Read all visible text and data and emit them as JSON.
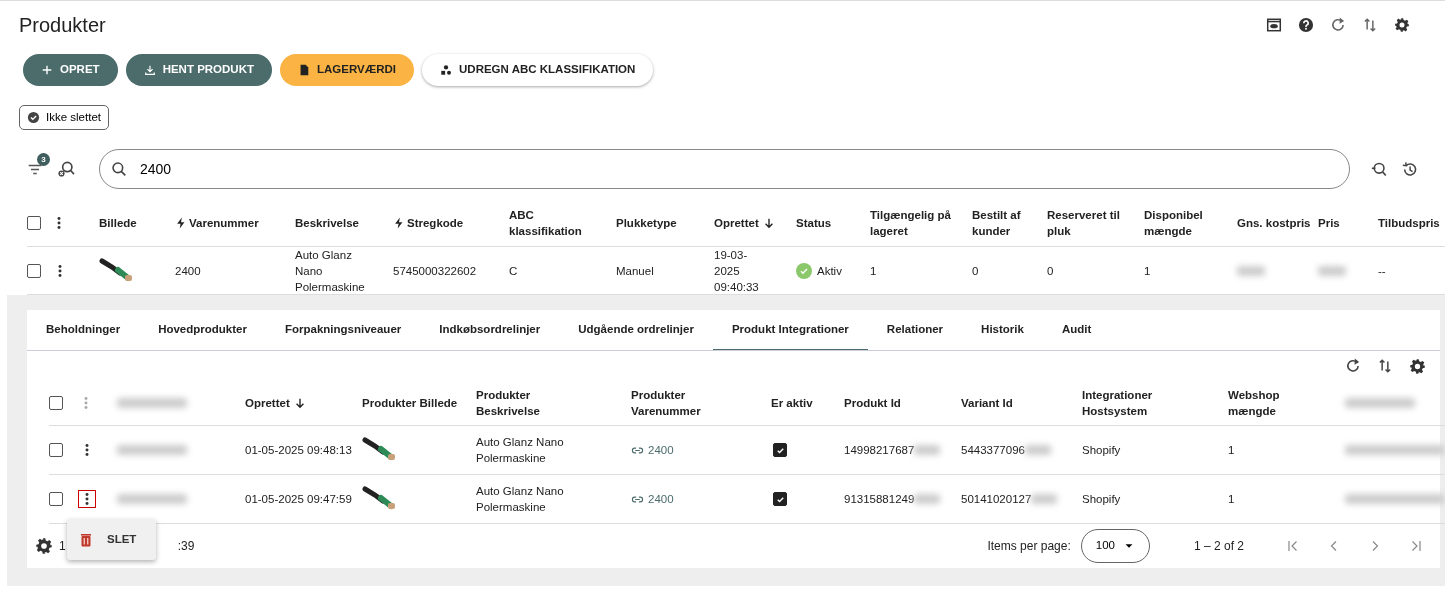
{
  "title": "Produkter",
  "action_buttons": [
    {
      "label": "OPRET",
      "kind": "primary"
    },
    {
      "label": "HENT PRODUKT",
      "kind": "primary"
    },
    {
      "label": "LAGERVÆRDI",
      "kind": "warning"
    },
    {
      "label": "UDREGN ABC KLASSIFIKATION",
      "kind": "light"
    }
  ],
  "filter_chip": {
    "label": "Ikke slettet",
    "checked": true
  },
  "filter_badge": "3",
  "search": {
    "value": "2400"
  },
  "table": {
    "all_selected": false,
    "columns": [
      {
        "label": "Billede"
      },
      {
        "label": "Varenummer",
        "quick": true
      },
      {
        "label": "Beskrivelse"
      },
      {
        "label": "Stregkode",
        "quick": true
      },
      {
        "label": "ABC klassifikation"
      },
      {
        "label": "Plukketype"
      },
      {
        "label": "Oprettet",
        "sorted": true
      },
      {
        "label": "Status"
      },
      {
        "label": "Tilgængelig på lageret"
      },
      {
        "label": "Bestilt af kunder"
      },
      {
        "label": "Reserveret til pluk"
      },
      {
        "label": "Disponibel mængde"
      },
      {
        "label": "Gns. kostpris"
      },
      {
        "label": "Pris"
      },
      {
        "label": "Tilbudspris"
      }
    ],
    "rows": [
      {
        "selected": false,
        "cells": [
          {
            "kind": "image"
          },
          {
            "kind": "text",
            "text": "2400"
          },
          {
            "kind": "text",
            "text": "Auto Glanz Nano Polermaskine"
          },
          {
            "kind": "text",
            "text": "5745000322602"
          },
          {
            "kind": "text",
            "text": "C"
          },
          {
            "kind": "text",
            "text": "Manuel"
          },
          {
            "kind": "text",
            "text": "19-03-2025 09:40:33"
          },
          {
            "kind": "status",
            "text": "Aktiv",
            "active": true
          },
          {
            "kind": "text",
            "text": "1"
          },
          {
            "kind": "text",
            "text": "0"
          },
          {
            "kind": "text",
            "text": "0"
          },
          {
            "kind": "text",
            "text": "1"
          },
          {
            "kind": "redacted"
          },
          {
            "kind": "redacted"
          },
          {
            "kind": "text",
            "text": "--"
          }
        ]
      }
    ]
  },
  "detail_tabs": [
    {
      "label": "Beholdninger",
      "selected": false
    },
    {
      "label": "Hovedprodukter",
      "selected": false
    },
    {
      "label": "Forpakningsniveauer",
      "selected": false
    },
    {
      "label": "Indkøbsordrelinjer",
      "selected": false
    },
    {
      "label": "Udgående ordrelinjer",
      "selected": false
    },
    {
      "label": "Produkt Integrationer",
      "selected": true
    },
    {
      "label": "Relationer",
      "selected": false
    },
    {
      "label": "Historik",
      "selected": false
    },
    {
      "label": "Audit",
      "selected": false
    }
  ],
  "detail_table": {
    "all_selected": false,
    "columns": [
      {
        "kind": "redacted"
      },
      {
        "kind": "text",
        "label": "Oprettet",
        "sorted": true
      },
      {
        "kind": "text",
        "label": "Produkter Billede"
      },
      {
        "kind": "text",
        "label": "Produkter Beskrivelse"
      },
      {
        "kind": "text",
        "label": "Produkter Varenummer"
      },
      {
        "kind": "text",
        "label": "Er aktiv"
      },
      {
        "kind": "text",
        "label": "Produkt Id"
      },
      {
        "kind": "text",
        "label": "Variant Id"
      },
      {
        "kind": "text",
        "label": "Integrationer Hostsystem"
      },
      {
        "kind": "text",
        "label": "Webshop mængde"
      },
      {
        "kind": "redacted"
      }
    ],
    "rows": [
      {
        "selected": false,
        "menu_open": false,
        "cells": [
          {
            "kind": "redacted"
          },
          {
            "kind": "text",
            "text": "01-05-2025 09:48:13"
          },
          {
            "kind": "image"
          },
          {
            "kind": "text",
            "text": "Auto Glanz Nano Polermaskine"
          },
          {
            "kind": "link",
            "text": "2400"
          },
          {
            "kind": "checkbox",
            "checked": true
          },
          {
            "kind": "partial",
            "text": "14998217687"
          },
          {
            "kind": "partial",
            "text": "5443377096"
          },
          {
            "kind": "text",
            "text": "Shopify"
          },
          {
            "kind": "text",
            "text": "1"
          },
          {
            "kind": "redacted"
          }
        ]
      },
      {
        "selected": false,
        "menu_open": true,
        "cells": [
          {
            "kind": "redacted"
          },
          {
            "kind": "text",
            "text": "01-05-2025 09:47:59"
          },
          {
            "kind": "image"
          },
          {
            "kind": "text",
            "text": "Auto Glanz Nano Polermaskine"
          },
          {
            "kind": "link",
            "text": "2400"
          },
          {
            "kind": "checkbox",
            "checked": true
          },
          {
            "kind": "partial",
            "text": "91315881249"
          },
          {
            "kind": "partial",
            "text": "50141020127"
          },
          {
            "kind": "text",
            "text": "Shopify"
          },
          {
            "kind": "text",
            "text": "1"
          },
          {
            "kind": "redacted"
          }
        ]
      }
    ]
  },
  "row_menu": [
    {
      "label": "SLET"
    }
  ],
  "footer": {
    "text_start": "1",
    "text_end": ":39"
  },
  "pagination": {
    "label": "Items per page:",
    "per_page": "100",
    "range": "1 – 2 of 2"
  }
}
